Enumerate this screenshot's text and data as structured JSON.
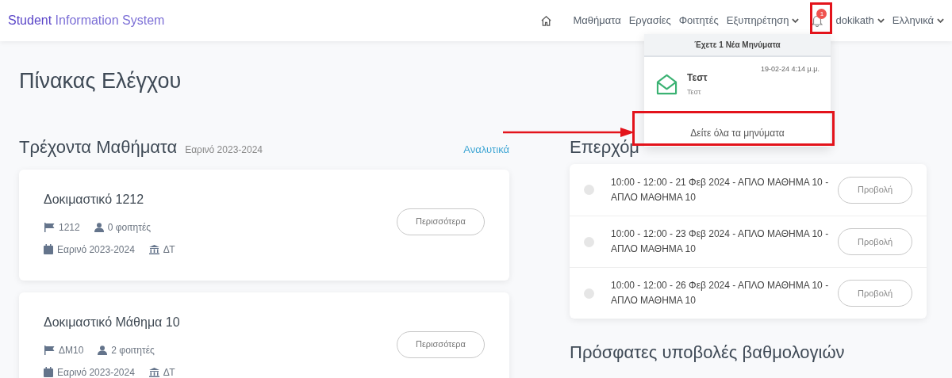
{
  "navbar": {
    "brand_bold": "Student",
    "brand_rest": "Information System",
    "links": [
      {
        "label": "Μαθήματα",
        "dropdown": false
      },
      {
        "label": "Εργασίες",
        "dropdown": false
      },
      {
        "label": "Φοιτητές",
        "dropdown": false
      },
      {
        "label": "Εξυπηρέτηση",
        "dropdown": true
      }
    ],
    "notifications_badge": "1",
    "user": "dokikath",
    "language": "Ελληνικά"
  },
  "notifications_menu": {
    "header": "Έχετε 1 Νέα Μηνύματα",
    "messages": [
      {
        "time": "19-02-24 4:14 μ.μ.",
        "title": "Τεστ",
        "body": "Τεστ"
      }
    ],
    "footer_link": "Δείτε όλα τα μηνύματα"
  },
  "page_title": "Πίνακας Ελέγχου",
  "current_courses": {
    "title": "Τρέχοντα Μαθήματα",
    "semester": "Εαρινό 2023-2024",
    "link": "Αναλυτικά",
    "courses": [
      {
        "name": "Δοκιμαστικό 1212",
        "code": "1212",
        "students": "0 φοιτητές",
        "semester": "Εαρινό 2023-2024",
        "department": "ΔΤ",
        "button": "Περισσότερα"
      },
      {
        "name": "Δοκιμαστικό Μάθημα 10",
        "code": "ΔΜ10",
        "students": "2 φοιτητές",
        "semester": "Εαρινό 2023-2024",
        "department": "ΔΤ",
        "button": "Περισσότερα"
      }
    ]
  },
  "upcoming": {
    "title": "Επερχόμ",
    "events": [
      {
        "text": "10:00 - 12:00 - 21 Φεβ 2024 - ΑΠΛΟ ΜΑΘΗΜΑ 10 - ΑΠΛΟ ΜΑΘΗΜΑ 10",
        "button": "Προβολή"
      },
      {
        "text": "10:00 - 12:00 - 23 Φεβ 2024 - ΑΠΛΟ ΜΑΘΗΜΑ 10 - ΑΠΛΟ ΜΑΘΗΜΑ 10",
        "button": "Προβολή"
      },
      {
        "text": "10:00 - 12:00 - 26 Φεβ 2024 - ΑΠΛΟ ΜΑΘΗΜΑ 10 - ΑΠΛΟ ΜΑΘΗΜΑ 10",
        "button": "Προβολή"
      }
    ]
  },
  "recent_grades": {
    "title": "Πρόσφατες υποβολές βαθμολογιών"
  }
}
